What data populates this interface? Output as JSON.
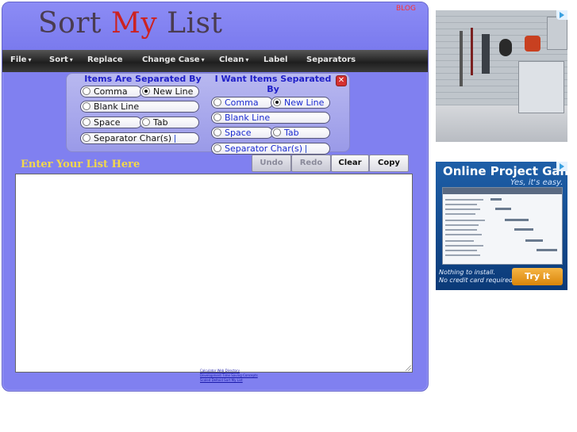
{
  "header": {
    "title_part1": "Sort ",
    "title_part2": "My",
    "title_part3": " List",
    "blog_link": "BLOG"
  },
  "menu": {
    "items": [
      {
        "label": "File",
        "has_caret": true
      },
      {
        "label": "Sort",
        "has_caret": true
      },
      {
        "label": "Replace",
        "has_caret": false
      },
      {
        "label": "Change Case",
        "has_caret": true
      },
      {
        "label": "Clean",
        "has_caret": true
      },
      {
        "label": "Label",
        "has_caret": false
      },
      {
        "label": "Separators",
        "has_caret": false
      }
    ],
    "caret": "▾"
  },
  "separators": {
    "input_group": {
      "title": "Items Are Separated By",
      "options": {
        "comma": "Comma",
        "new_line": "New Line",
        "blank_line": "Blank Line",
        "space": "Space",
        "tab": "Tab",
        "separator_chars": "Separator Char(s)"
      },
      "selected": "New Line"
    },
    "output_group": {
      "title_line1": "I Want Items Separated",
      "title_line2": "By",
      "options": {
        "comma": "Comma",
        "new_line": "New Line",
        "blank_line": "Blank Line",
        "space": "Space",
        "tab": "Tab",
        "separator_chars": "Separator Char(s)"
      },
      "selected": "New Line"
    },
    "close_glyph": "✕"
  },
  "editor": {
    "label": "Enter Your List Here",
    "text": "",
    "buttons": {
      "undo": "Undo",
      "redo": "Redo",
      "clear": "Clear",
      "copy": "Copy"
    }
  },
  "footer": {
    "links": [
      "Calculator Web Directory",
      "Development Time Saving Concepts",
      "Scaled Deltoid Sort My List"
    ]
  },
  "ads": {
    "ad1": {
      "icon": "ad-choices-icon"
    },
    "ad2": {
      "headline": "Online Project Gantt",
      "tagline": "Yes, it's easy.",
      "note_line1": "Nothing to install.",
      "note_line2": "No credit card required.",
      "cta": "Try it FREE!"
    }
  },
  "colors": {
    "app_background": "#8080f0",
    "menubar": "#2a2a2a",
    "title_accent": "#cc2222",
    "list_label": "#f2d84c",
    "gantt_ad": "#1e5fa8",
    "cta": "#e89a20"
  }
}
